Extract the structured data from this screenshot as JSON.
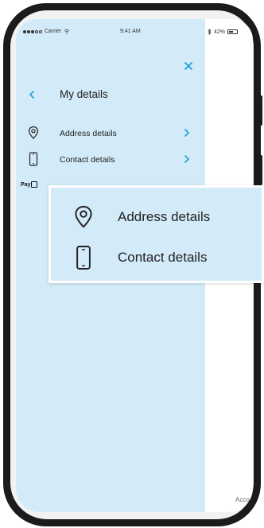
{
  "status_bar": {
    "carrier": "Carrier",
    "time": "9:41 AM",
    "battery": "42%"
  },
  "drawer": {
    "title": "My details",
    "items": [
      {
        "label": "Address details",
        "icon": "location-pin-icon"
      },
      {
        "label": "Contact details",
        "icon": "mobile-phone-icon"
      }
    ]
  },
  "pay_badge": {
    "label": "Pay"
  },
  "footer": {
    "text": "Acco"
  },
  "zoom": {
    "items": [
      {
        "label": "Address details",
        "icon": "location-pin-icon"
      },
      {
        "label": "Contact details",
        "icon": "mobile-phone-icon"
      }
    ]
  },
  "colors": {
    "drawer_bg": "#d3ebf8",
    "accent": "#1a9fd6",
    "phone_frame": "#1b1b1b"
  }
}
